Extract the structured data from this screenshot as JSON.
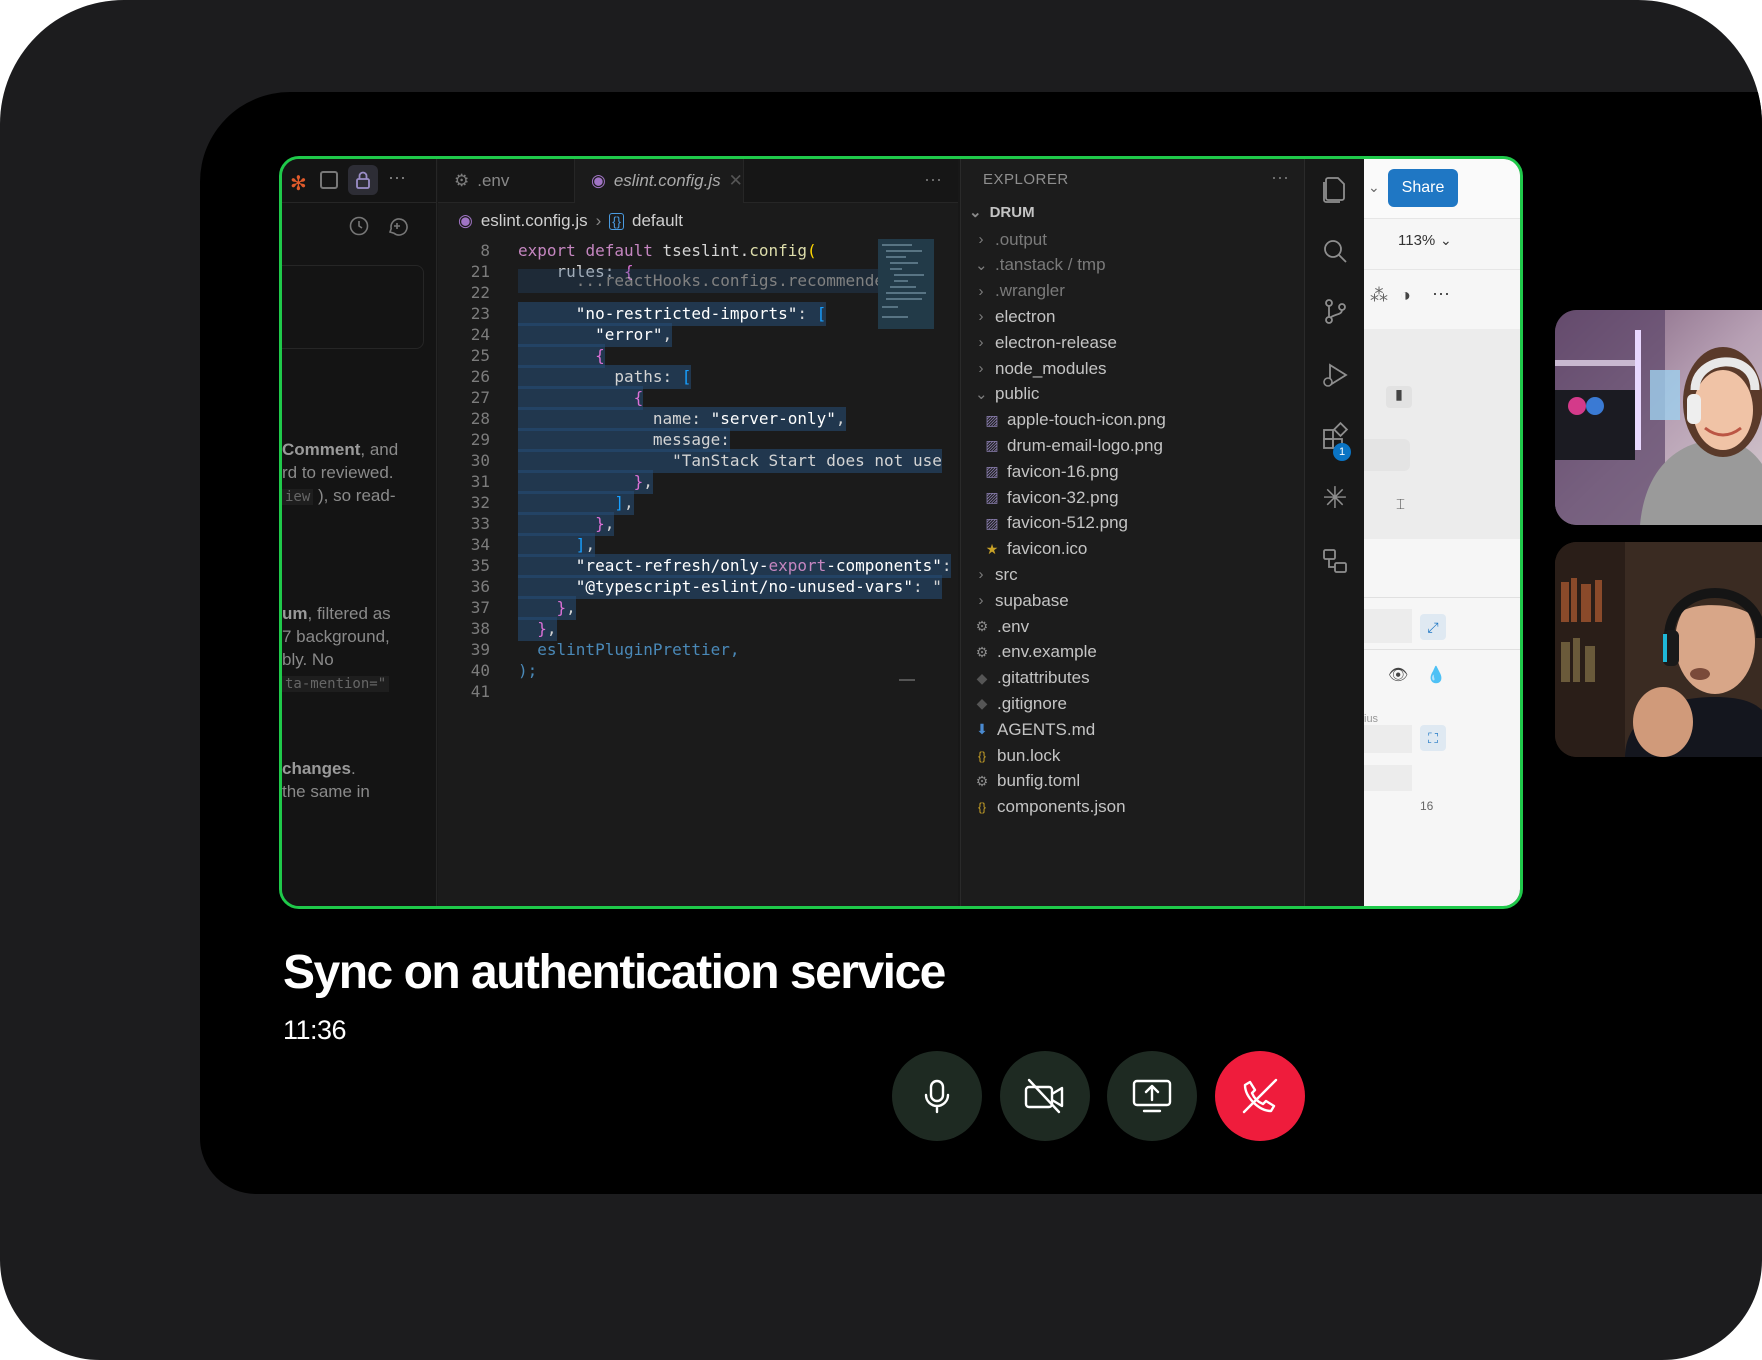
{
  "meeting": {
    "title": "Sync on authentication service",
    "time": "11:36"
  },
  "controls": [
    {
      "name": "microphone",
      "icon": "microphone-icon"
    },
    {
      "name": "camera-off",
      "icon": "camera-off-icon"
    },
    {
      "name": "screen-share",
      "icon": "screen-share-icon"
    },
    {
      "name": "end-call",
      "icon": "end-call-icon",
      "color": "#ef1c3c"
    }
  ],
  "share_border_color": "#1fc94a",
  "shared_screen": {
    "left_pane": {
      "lines": [
        {
          "bold": "Comment",
          "rest": ", and"
        },
        {
          "bold": "",
          "rest": "rd to reviewed."
        },
        {
          "bold": "",
          "mono": "iew",
          "rest": " ), so read-"
        },
        {
          "bold": "um",
          "rest": ", filtered as"
        },
        {
          "bold": "",
          "rest": "7  background,"
        },
        {
          "bold": "",
          "rest": "bly. No"
        },
        {
          "bold": "",
          "mono": "ta-mention=\"",
          "rest": ""
        },
        {
          "bold": "changes",
          "rest": "."
        },
        {
          "bold": "",
          "rest": "the same in"
        }
      ]
    },
    "tabs": [
      {
        "label": ".env",
        "active": false
      },
      {
        "label": "eslint.config.js",
        "active": true
      }
    ],
    "breadcrumb": {
      "file": "eslint.config.js",
      "symbol": "default"
    },
    "code_lines": [
      {
        "n": "8",
        "html": "export default tseslint.config("
      },
      {
        "n": "21",
        "html": "    rules: {"
      },
      {
        "n": "22",
        "html": "      ...reactHooks.configs.recommende"
      },
      {
        "n": "23",
        "html": "      \"no-restricted-imports\": ["
      },
      {
        "n": "24",
        "html": "        \"error\","
      },
      {
        "n": "25",
        "html": "        {"
      },
      {
        "n": "26",
        "html": "          paths: ["
      },
      {
        "n": "27",
        "html": "            {"
      },
      {
        "n": "28",
        "html": "              name: \"server-only\","
      },
      {
        "n": "29",
        "html": "              message:"
      },
      {
        "n": "30",
        "html": "                \"TanStack Start does not use"
      },
      {
        "n": "31",
        "html": "            },"
      },
      {
        "n": "32",
        "html": "          ],"
      },
      {
        "n": "33",
        "html": "        },"
      },
      {
        "n": "34",
        "html": "      ],"
      },
      {
        "n": "35",
        "html": "      \"react-refresh/only-export-components\":"
      },
      {
        "n": "36",
        "html": "      \"@typescript-eslint/no-unused-vars\": \""
      },
      {
        "n": "37",
        "html": "    },"
      },
      {
        "n": "38",
        "html": "  },"
      },
      {
        "n": "39",
        "html": "  eslintPluginPrettier,"
      },
      {
        "n": "40",
        "html": ");"
      },
      {
        "n": "41",
        "html": ""
      }
    ],
    "explorer": {
      "header": "EXPLORER",
      "root": "DRUM",
      "items": [
        {
          "label": ".output",
          "type": "folder",
          "depth": 0,
          "open": false,
          "dim": true
        },
        {
          "label": ".tanstack / tmp",
          "type": "folder",
          "depth": 0,
          "open": true,
          "dim": true
        },
        {
          "label": ".wrangler",
          "type": "folder",
          "depth": 0,
          "open": false,
          "dim": true
        },
        {
          "label": "electron",
          "type": "folder",
          "depth": 0,
          "open": false,
          "dim": false
        },
        {
          "label": "electron-release",
          "type": "folder",
          "depth": 0,
          "open": false,
          "dim": false
        },
        {
          "label": "node_modules",
          "type": "folder",
          "depth": 0,
          "open": false,
          "dim": false
        },
        {
          "label": "public",
          "type": "folder",
          "depth": 0,
          "open": true,
          "dim": false
        },
        {
          "label": "apple-touch-icon.png",
          "type": "image",
          "depth": 1
        },
        {
          "label": "drum-email-logo.png",
          "type": "image",
          "depth": 1
        },
        {
          "label": "favicon-16.png",
          "type": "image",
          "depth": 1
        },
        {
          "label": "favicon-32.png",
          "type": "image",
          "depth": 1
        },
        {
          "label": "favicon-512.png",
          "type": "image",
          "depth": 1
        },
        {
          "label": "favicon.ico",
          "type": "star",
          "depth": 1
        },
        {
          "label": "src",
          "type": "folder",
          "depth": 0,
          "open": false,
          "dim": false
        },
        {
          "label": "supabase",
          "type": "folder",
          "depth": 0,
          "open": false,
          "dim": false
        },
        {
          "label": ".env",
          "type": "gear",
          "depth": 0
        },
        {
          "label": ".env.example",
          "type": "gear",
          "depth": 0
        },
        {
          "label": ".gitattributes",
          "type": "git",
          "depth": 0
        },
        {
          "label": ".gitignore",
          "type": "git",
          "depth": 0
        },
        {
          "label": "AGENTS.md",
          "type": "md",
          "depth": 0
        },
        {
          "label": "bun.lock",
          "type": "json",
          "depth": 0
        },
        {
          "label": "bunfig.toml",
          "type": "gear",
          "depth": 0
        },
        {
          "label": "components.json",
          "type": "json",
          "depth": 0
        }
      ]
    },
    "activity_badge": "1",
    "right_pane": {
      "share_label": "Share",
      "zoom": "113%",
      "fragments": [
        "ius",
        "16"
      ]
    }
  },
  "participants": [
    {
      "name": "participant-1",
      "icon": "participant-video"
    },
    {
      "name": "participant-2",
      "icon": "participant-video"
    }
  ]
}
